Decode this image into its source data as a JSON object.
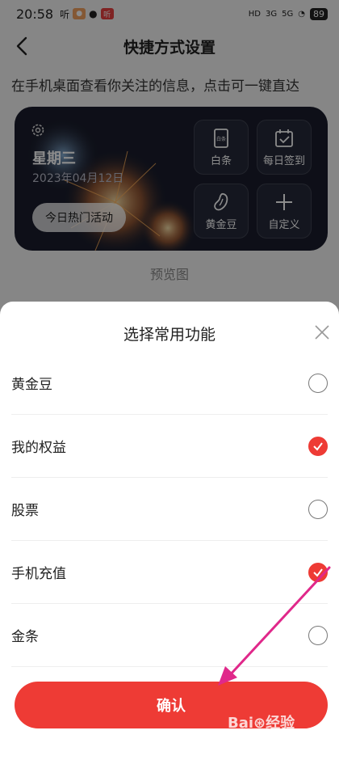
{
  "status_bar": {
    "time": "20:58",
    "app_1": "听",
    "app_3": "听",
    "network_1": "HD",
    "network_2": "3G",
    "network_3": "5G",
    "battery": "89"
  },
  "nav": {
    "title": "快捷方式设置"
  },
  "description": "在手机桌面查看你关注的信息，点击可一键直达",
  "widget": {
    "weekday": "星期三",
    "date": "2023年04月12日",
    "hot_button": "今日热门活动",
    "tiles": [
      {
        "label": "白条",
        "icon": "baitiao-card-icon",
        "icon_text": "白条"
      },
      {
        "label": "每日签到",
        "icon": "calendar-check-icon"
      },
      {
        "label": "黄金豆",
        "icon": "bean-icon"
      },
      {
        "label": "自定义",
        "icon": "plus-icon"
      }
    ]
  },
  "preview_label": "预览图",
  "sheet": {
    "title": "选择常用功能",
    "options": [
      {
        "label": "黄金豆",
        "checked": false
      },
      {
        "label": "我的权益",
        "checked": true
      },
      {
        "label": "股票",
        "checked": false
      },
      {
        "label": "手机充值",
        "checked": true
      },
      {
        "label": "金条",
        "checked": false
      }
    ],
    "confirm_label": "确认"
  },
  "colors": {
    "accent": "#ee3b35",
    "annotation_arrow": "#e0288a"
  }
}
